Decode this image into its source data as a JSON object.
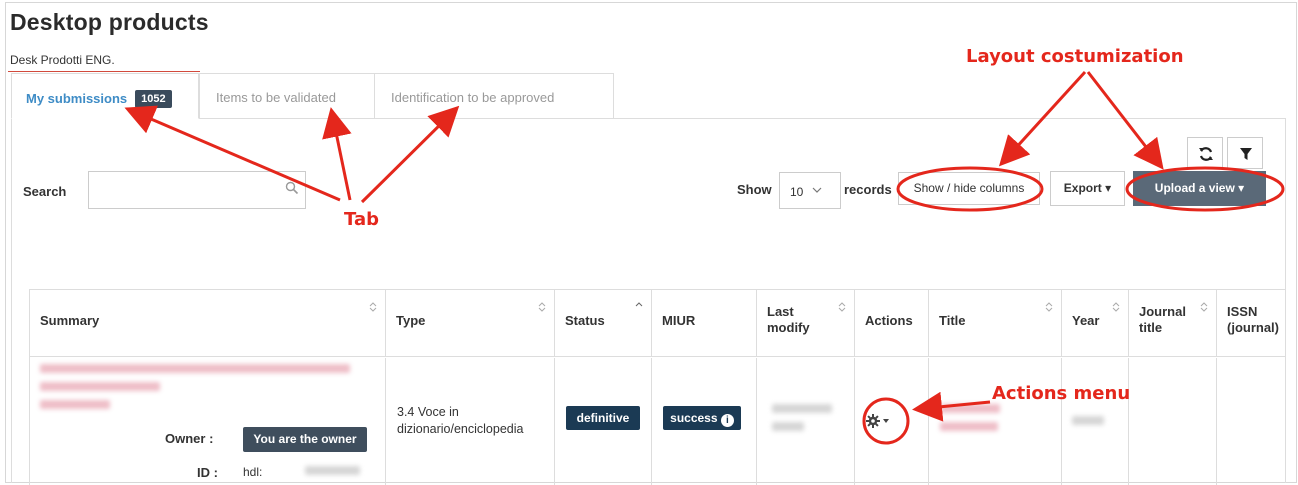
{
  "page": {
    "title": "Desktop products",
    "breadcrumb": "Desk Prodotti ENG."
  },
  "tabs": [
    {
      "label": "My submissions",
      "badge": "1052",
      "active": true
    },
    {
      "label": "Items to be validated",
      "active": false
    },
    {
      "label": "Identification to be approved",
      "active": false
    }
  ],
  "toolbar": {
    "search_label": "Search",
    "search_value": "",
    "show_label": "Show",
    "page_length": "10",
    "records_label": "records",
    "columns_button": "Show / hide columns",
    "export_button": "Export",
    "upload_button": "Upload a view",
    "refresh_icon": "refresh-icon",
    "filter_icon": "filter-icon"
  },
  "table": {
    "columns": [
      "Summary",
      "Type",
      "Status",
      "MIUR",
      "Last modify",
      "Actions",
      "Title",
      "Year",
      "Journal title",
      "ISSN (journal)"
    ],
    "row": {
      "owner_label": "Owner :",
      "owner_value": "You are the owner",
      "id_label": "ID :",
      "id_value": "hdl:",
      "type": "3.4 Voce in dizionario/enciclopedia",
      "status": "definitive",
      "miur": "success",
      "actions_icon": "gear-icon"
    }
  },
  "annotations": {
    "layout": "Layout costumization",
    "tab": "Tab",
    "actions": "Actions menu"
  },
  "colors": {
    "annotation": "#e4271c",
    "dark_badge": "#1b3a54",
    "upload_button": "#5a6978",
    "active_tab": "#3e8cc6"
  }
}
